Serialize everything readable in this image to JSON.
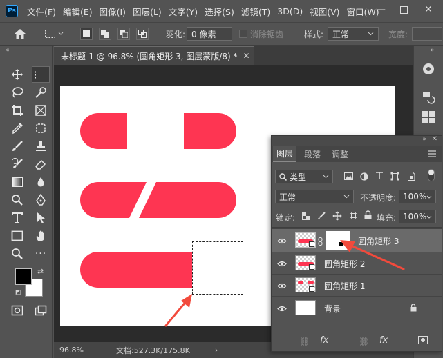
{
  "app": {
    "logo": "Ps"
  },
  "menu": [
    "文件(F)",
    "编辑(E)",
    "图像(I)",
    "图层(L)",
    "文字(Y)",
    "选择(S)",
    "滤镜(T)",
    "3D(D)",
    "视图(V)",
    "窗口(W)"
  ],
  "options": {
    "feather_label": "羽化:",
    "feather_value": "0 像素",
    "antialias_label": "消除锯齿",
    "style_label": "样式:",
    "style_value": "正常",
    "width_label": "宽度:"
  },
  "document": {
    "tab_title": "未标题-1 @ 96.8% (圆角矩形 3, 图层蒙版/8) *",
    "zoom": "96.8%",
    "doc_size": "文档:527.3K/175.8K"
  },
  "layers_panel": {
    "tabs": [
      "图层",
      "段落",
      "调整"
    ],
    "filter_kind": "类型",
    "blend_mode": "正常",
    "opacity_label": "不透明度:",
    "opacity_value": "100%",
    "lock_label": "锁定:",
    "fill_label": "填充:",
    "fill_value": "100%",
    "layers": [
      {
        "name": "圆角矩形 3",
        "selected": true
      },
      {
        "name": "圆角矩形 2",
        "selected": false
      },
      {
        "name": "圆角矩形 1",
        "selected": false
      },
      {
        "name": "背景",
        "selected": false
      }
    ]
  },
  "colors": {
    "shape_fill": "#fe3552",
    "arrow": "#f24a3c",
    "foreground": "#000000",
    "background": "#ffffff"
  }
}
